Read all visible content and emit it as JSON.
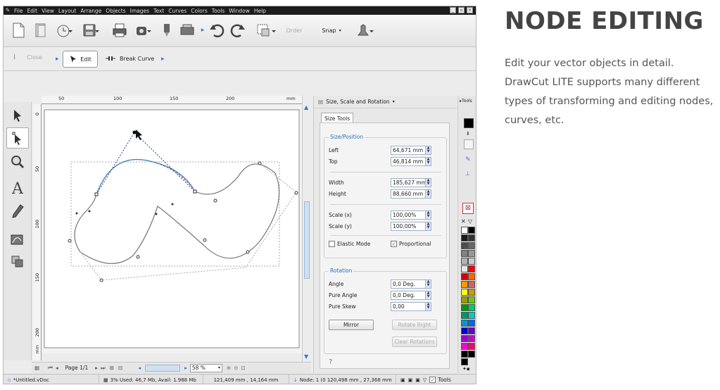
{
  "app": {
    "menu": [
      "File",
      "Edit",
      "View",
      "Layout",
      "Arrange",
      "Objects",
      "Images",
      "Text",
      "Curves",
      "Colors",
      "Tools",
      "Window",
      "Help"
    ],
    "toolbar": {
      "order_label": "Order",
      "snap_label": "Snap"
    },
    "node_toolbar": {
      "close_label": "Close",
      "edit_label": "Edit",
      "break_curve_label": "Break Curve"
    },
    "hruler_ticks": [
      "50",
      "100",
      "150",
      "200",
      "mm"
    ],
    "vruler_ticks": [
      "0",
      "50",
      "100",
      "150",
      "200",
      "mm"
    ],
    "bottom": {
      "page_label": "Page 1/1",
      "zoom": "58 %"
    },
    "status": {
      "doc": "*Untitled.vDoc",
      "memory": "3%  Used: 46,7 Mb, Avail: 1.988 Mb",
      "coords": "121,409 mm , 14,164 mm",
      "node": "Node: 1 (0  120,498 mm , 27,368 mm",
      "tools": "Tools"
    },
    "panel": {
      "title": "Size, Scale and Rotation",
      "tools_label": "Tools",
      "tab": "Size Tools",
      "size_position": {
        "title": "Size/Position",
        "left_label": "Left",
        "left": "64,671 mm",
        "top_label": "Top",
        "top": "46,814 mm",
        "width_label": "Width",
        "width": "185,627 mm",
        "height_label": "Height",
        "height": "88,660 mm",
        "scalex_label": "Scale (x)",
        "scalex": "100,00%",
        "scaley_label": "Scale (y)",
        "scaley": "100,00%",
        "elastic_label": "Elastic Mode",
        "elastic_checked": false,
        "proportional_label": "Proportional",
        "proportional_checked": true
      },
      "rotation": {
        "title": "Rotation",
        "angle_label": "Angle",
        "angle": "0,0 Deg.",
        "pure_angle_label": "Pure Angle",
        "pure_angle": "0,0 Deg.",
        "pure_skew_label": "Pure Skew",
        "pure_skew": "0,00",
        "mirror_label": "Mirror",
        "rotate_right_label": "Rotate Right",
        "clear_rotations_label": "Clear Rotations"
      }
    },
    "palette_colors": [
      "#ffffff",
      "#000000",
      "#1a1a1a",
      "#333333",
      "#4d4d4d",
      "#666666",
      "#808080",
      "#999999",
      "#b3b3b3",
      "#cccccc",
      "#e6e6e6",
      "#ff0000",
      "#cc0000",
      "#ff6600",
      "#ff9900",
      "#cc6666",
      "#ffff00",
      "#cc9900",
      "#999900",
      "#66cc00",
      "#009900",
      "#00cc66",
      "#009966",
      "#00cccc",
      "#0099cc",
      "#0066ff",
      "#0000cc",
      "#6600cc",
      "#9900cc",
      "#cc00cc",
      "#ff00cc",
      "#ff0066",
      "#000000",
      "#000000",
      "#000000"
    ]
  },
  "page": {
    "heading": "NODE EDITING",
    "description": "Edit your vector objects in detail. DrawCut LITE supports many different types of transforming and editing nodes, curves, etc."
  }
}
